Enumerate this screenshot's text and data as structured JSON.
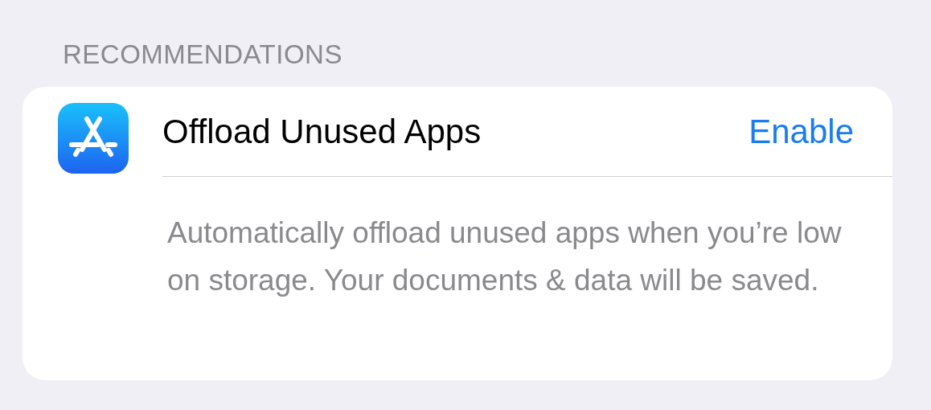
{
  "section_header": "RECOMMENDATIONS",
  "recommendation": {
    "title": "Offload Unused Apps",
    "action": "Enable",
    "description": "Automatically offload unused apps when you’re low on storage. Your documents & data will be saved."
  }
}
